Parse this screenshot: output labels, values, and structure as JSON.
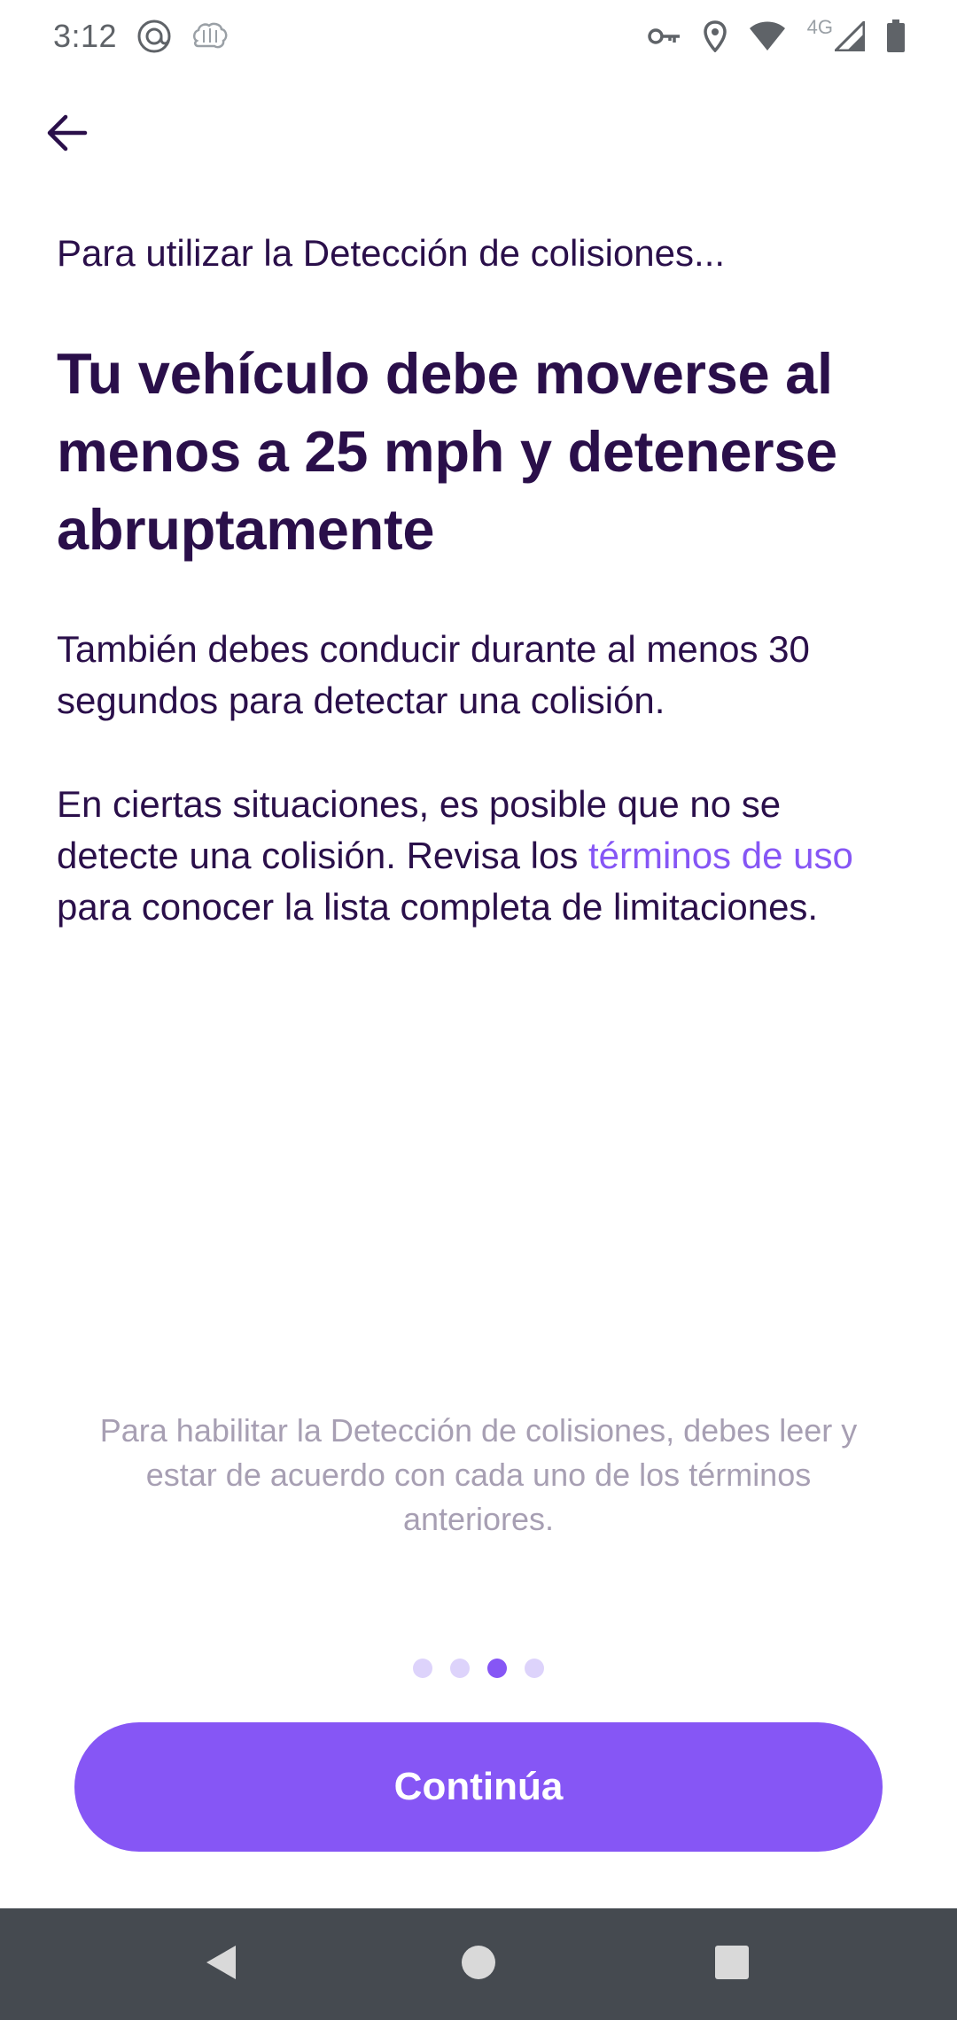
{
  "status_bar": {
    "time": "3:12",
    "network_label": "4G",
    "icons": [
      "at-sign-icon",
      "brain-icon",
      "vpn-key-icon",
      "location-icon",
      "wifi-icon",
      "cell-signal-icon",
      "battery-icon"
    ]
  },
  "header": {
    "back_icon": "arrow-left-icon"
  },
  "main": {
    "intro": "Para utilizar la Detección de colisiones...",
    "headline": "Tu vehículo debe moverse al menos a 25 mph y detenerse abruptamente",
    "paragraph1": "También debes conducir durante al menos 30 segundos para detectar una colisión.",
    "paragraph2_before": "En ciertas situaciones, es posible que no se detecte una colisión. Revisa los ",
    "paragraph2_link": "términos de uso",
    "paragraph2_after": " para conocer la lista completa de limitaciones.",
    "footnote": "Para habilitar la Detección de colisiones, debes leer y estar de acuerdo con cada uno de los términos anteriores."
  },
  "pager": {
    "total": 4,
    "active_index": 2
  },
  "continue_label": "Continúa",
  "nav_bar": {
    "icons": [
      "back-triangle-icon",
      "home-circle-icon",
      "recents-square-icon"
    ]
  },
  "colors": {
    "accent": "#8656f5",
    "text": "#2a0f4a",
    "muted": "#a79fb3",
    "nav_background": "#454a50"
  }
}
